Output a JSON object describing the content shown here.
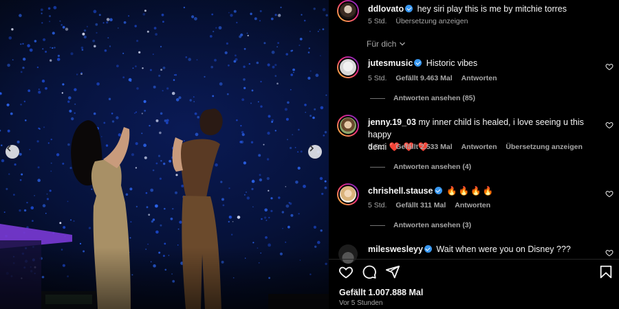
{
  "post": {
    "caption": {
      "username": "ddlovato",
      "text": "hey siri play this is me by mitchie torres",
      "time": "5 Std.",
      "translate": "Übersetzung anzeigen"
    },
    "filter_label": "Für dich",
    "likes": "Gefällt 1.007.888 Mal",
    "posted": "Vor 5 Stunden"
  },
  "comments": [
    {
      "username": "jutesmusic",
      "text": "Historic vibes",
      "time": "5 Std.",
      "likes": "Gefällt 9.463 Mal",
      "reply": "Antworten",
      "replies": "Antworten ansehen (85)"
    },
    {
      "username": "jenny.19_03",
      "text": "my inner child is healed, i love seeing u this happy",
      "text2": "demi",
      "emoji": "❤️ ❤️ ❤️",
      "time": "5 Std.",
      "likes": "Gefällt 2.533 Mal",
      "reply": "Antworten",
      "translate": "Übersetzung anzeigen",
      "replies": "Antworten ansehen (4)"
    },
    {
      "username": "chrishell.stause",
      "emoji": "🔥🔥🔥🔥",
      "time": "5 Std.",
      "likes": "Gefällt 311 Mal",
      "reply": "Antworten",
      "replies": "Antworten ansehen (3)"
    },
    {
      "username": "mileswesleyy",
      "text": "Wait when were you on Disney ???"
    }
  ],
  "icons": {
    "verified": "verified-badge-icon",
    "like": "heart-icon",
    "comment": "comment-icon",
    "share": "share-icon",
    "save": "bookmark-icon",
    "prev": "chevron-left-icon",
    "next": "chevron-right-icon"
  },
  "colors": {
    "background": "#000000",
    "verified": "#3897f0",
    "muted": "#a8a8a8",
    "stage_light": "#1e4fd0"
  }
}
